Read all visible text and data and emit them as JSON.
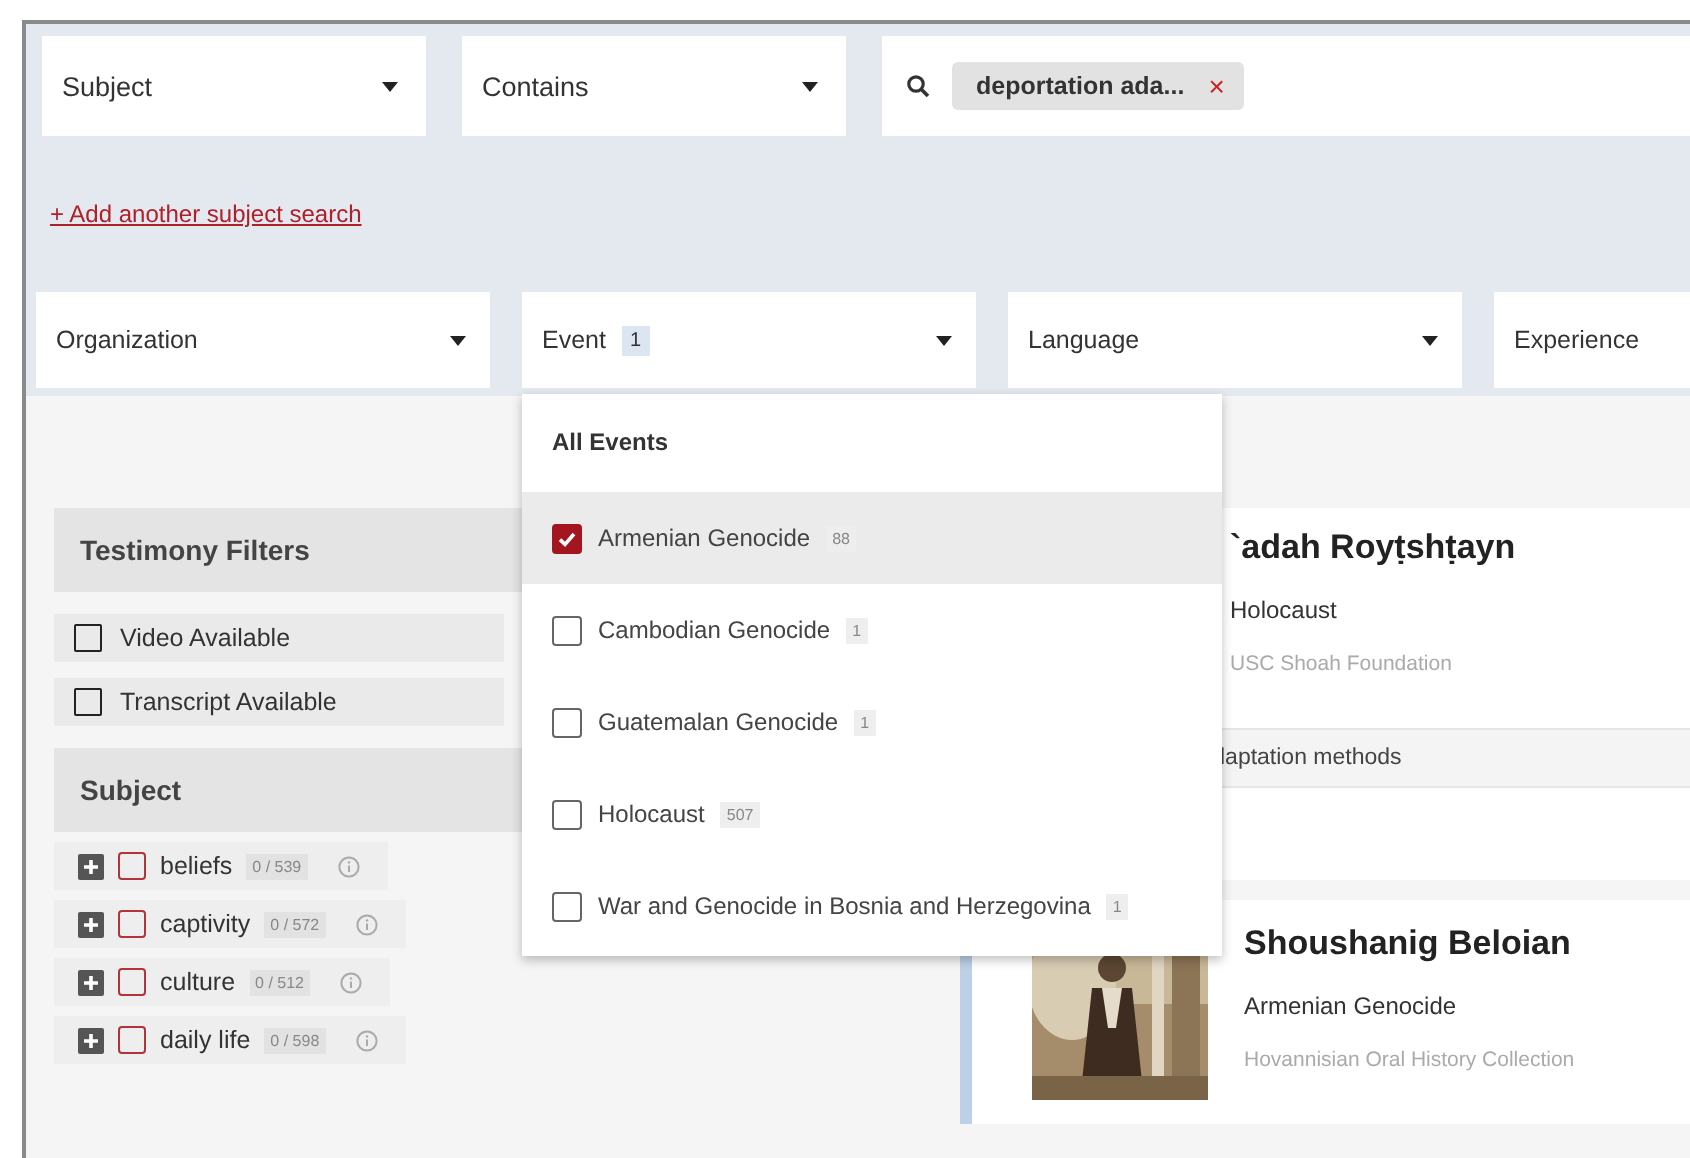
{
  "search_row": {
    "field_select": {
      "value": "Subject"
    },
    "operator_select": {
      "value": "Contains"
    },
    "search_chip": {
      "label": "deportation ada...",
      "remove": "×"
    }
  },
  "add_link": "+ Add another subject search",
  "filter_selects": [
    {
      "label": "Organization"
    },
    {
      "label": "Event",
      "count": "1",
      "menu": {
        "header": "All Events",
        "options": [
          {
            "label": "Armenian Genocide",
            "count": "88",
            "checked": true,
            "selected": true
          },
          {
            "label": "Cambodian Genocide",
            "count": "1",
            "checked": false,
            "selected": false
          },
          {
            "label": "Guatemalan Genocide",
            "count": "1",
            "checked": false,
            "selected": false
          },
          {
            "label": "Holocaust",
            "count": "507",
            "checked": false,
            "selected": false
          },
          {
            "label": "War and Genocide in Bosnia and Herzegovina",
            "count": "1",
            "checked": false,
            "selected": false
          }
        ]
      }
    },
    {
      "label": "Language"
    },
    {
      "label": "Experience"
    }
  ],
  "testimony_filters": {
    "title": "Testimony Filters",
    "options": [
      {
        "label": "Video Available",
        "checked": false
      },
      {
        "label": "Transcript Available",
        "checked": false
      }
    ]
  },
  "subject": {
    "title": "Subject",
    "items": [
      {
        "label": "beliefs",
        "count": "0 / 539",
        "checked": false
      },
      {
        "label": "captivity",
        "count": "0 / 572",
        "checked": false
      },
      {
        "label": "culture",
        "count": "0 / 512",
        "checked": false
      },
      {
        "label": "daily life",
        "count": "0 / 598",
        "checked": false
      }
    ]
  },
  "results": [
    {
      "name": "`adah Royṭshṭayn",
      "event": "Holocaust",
      "source": "USC Shoah Foundation",
      "tag": "laptation methods"
    },
    {
      "name": "Shoushanig Beloian",
      "event": "Armenian Genocide",
      "source": "Hovannisian Oral History Collection",
      "kind": "picture"
    }
  ]
}
